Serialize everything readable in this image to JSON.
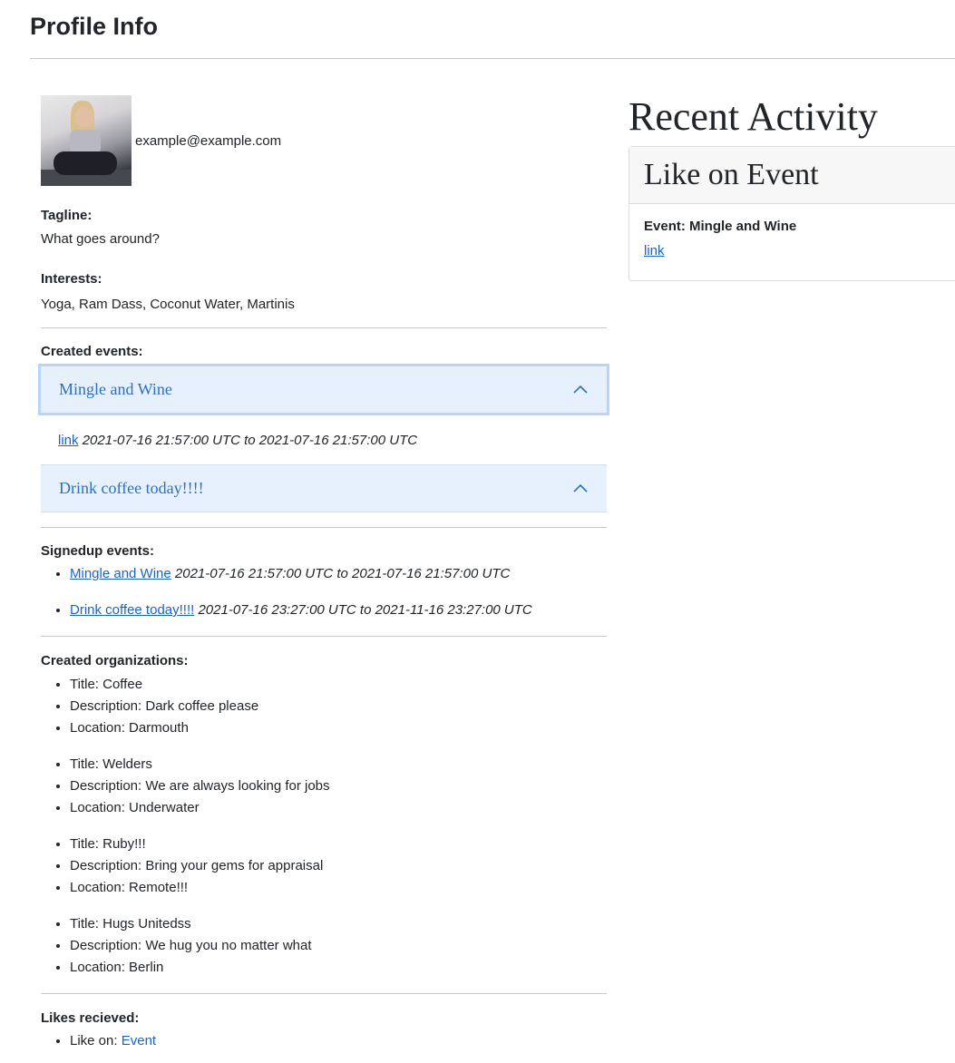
{
  "page": {
    "title": "Profile Info"
  },
  "profile": {
    "email": "example@example.com",
    "tagline_label": "Tagline:",
    "tagline": "What goes around?",
    "interests_label": "Interests:",
    "interests": "Yoga, Ram Dass, Coconut Water, Martinis"
  },
  "created_events": {
    "label": "Created events:",
    "items": [
      {
        "title": "Mingle and Wine",
        "link": "link",
        "dates": "2021-07-16 21:57:00 UTC to 2021-07-16 21:57:00 UTC",
        "expanded": true
      },
      {
        "title": "Drink coffee today!!!!",
        "expanded": false
      }
    ]
  },
  "signedup_events": {
    "label": "Signedup events:",
    "items": [
      {
        "title": "Mingle and Wine",
        "dates": "2021-07-16 21:57:00 UTC to 2021-07-16 21:57:00 UTC"
      },
      {
        "title": "Drink coffee today!!!!",
        "dates": "2021-07-16 23:27:00 UTC to 2021-11-16 23:27:00 UTC"
      }
    ]
  },
  "organizations": {
    "label": "Created organizations:",
    "items": [
      {
        "title": "Title: Coffee",
        "description": "Description: Dark coffee please",
        "location": "Location: Darmouth"
      },
      {
        "title": "Title: Welders",
        "description": "Description: We are always looking for jobs",
        "location": "Location: Underwater"
      },
      {
        "title": "Title: Ruby!!!",
        "description": "Description: Bring your gems for appraisal",
        "location": "Location: Remote!!!"
      },
      {
        "title": "Title: Hugs Unitedss",
        "description": "Description: We hug you no matter what",
        "location": "Location: Berlin"
      }
    ]
  },
  "likes": {
    "label": "Likes recieved:",
    "items": [
      {
        "prefix": "Like on: ",
        "target": "Event"
      }
    ]
  },
  "recent_activity": {
    "title": "Recent Activity",
    "card": {
      "header": "Like on Event",
      "event": "Event: Mingle and Wine",
      "link": "link"
    }
  },
  "icons": {
    "accordion_toggle": "chevron-up-icon"
  },
  "colors": {
    "link": "#1a64c9",
    "accordion_bg": "#e7f1fd",
    "accordion_text": "#2b6fc7"
  }
}
